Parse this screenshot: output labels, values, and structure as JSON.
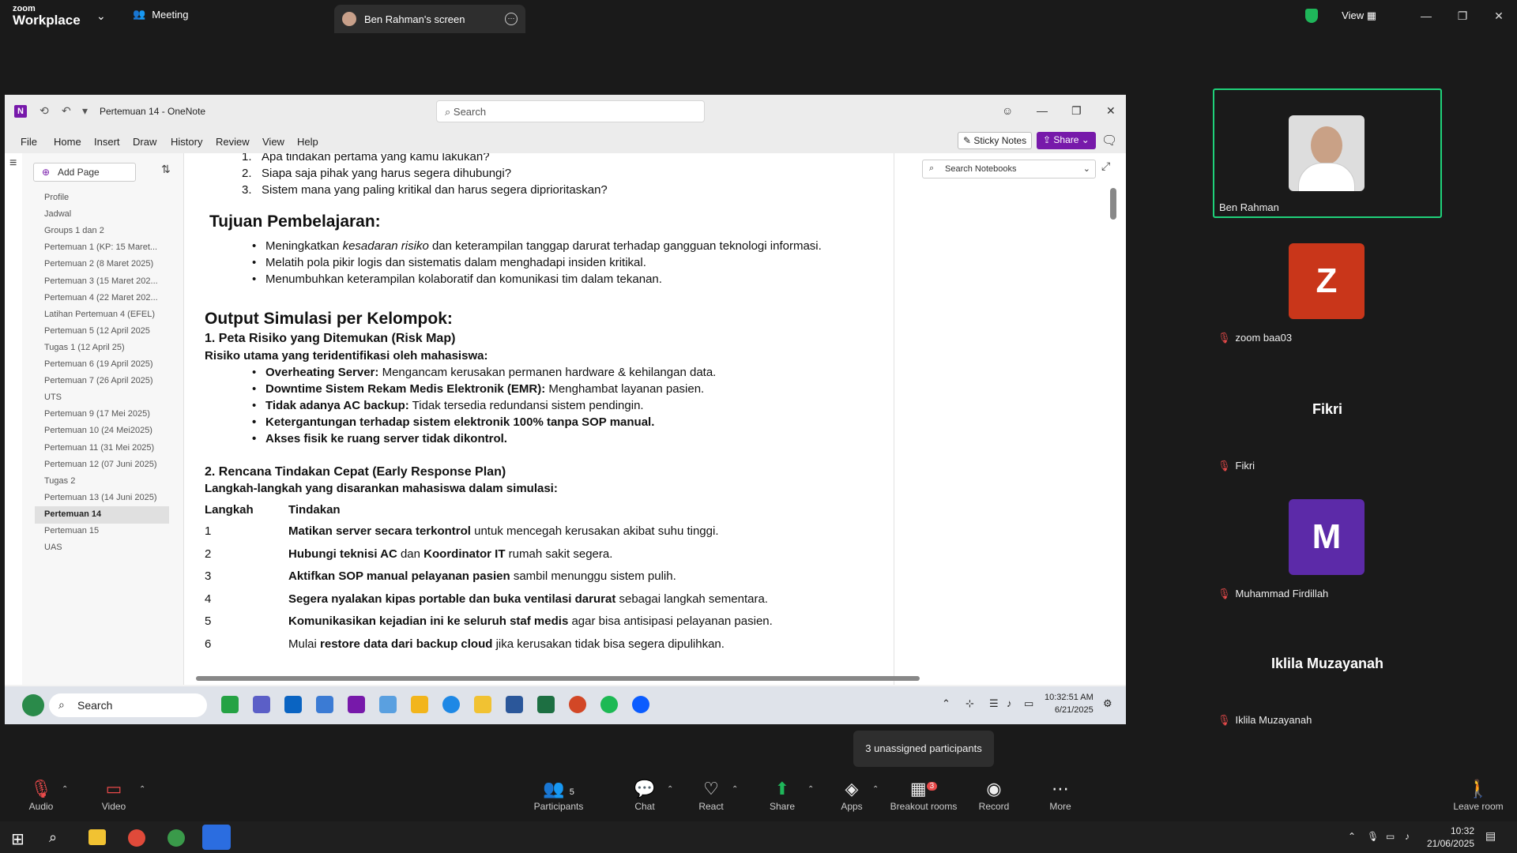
{
  "zoom_header": {
    "logo_small": "zoom",
    "logo_big": "Workplace",
    "meeting_label": "Meeting",
    "screen_tab_label": "Ben Rahman's screen",
    "view_label": "View"
  },
  "onenote": {
    "title": "Pertemuan 14 - OneNote",
    "search_placeholder": "Search",
    "menu": [
      "File",
      "Home",
      "Insert",
      "Draw",
      "History",
      "Review",
      "View",
      "Help"
    ],
    "sticky_notes": "Sticky Notes",
    "share": "Share",
    "add_page": "Add Page",
    "search_notebooks": "Search Notebooks",
    "pages": [
      "Profile",
      "Jadwal",
      "Groups 1 dan 2",
      "Pertemuan 1  (KP: 15 Maret...",
      "Pertemuan 2 (8 Maret 2025)",
      "Pertemuan 3 (15 Maret 202...",
      "Pertemuan 4 (22 Maret 202...",
      "Latihan Pertemuan 4 (EFEL)",
      "Pertemuan 5 (12 April 2025",
      "Tugas 1 (12 April 25)",
      "Pertemuan 6 (19 April 2025)",
      "Pertemuan 7 (26 April 2025)",
      "UTS",
      "Pertemuan 9 (17 Mei 2025)",
      "Pertemuan 10 (24 Mei2025)",
      "Pertemuan 11 (31 Mei 2025)",
      "Pertemuan 12 (07 Juni 2025)",
      "Tugas 2",
      "Pertemuan 13 (14 Juni 2025)",
      "Pertemuan 14",
      "Pertemuan 15",
      "UAS"
    ],
    "selected_page": "Pertemuan 14",
    "doc": {
      "q1": "Apa tindakan pertama yang kamu lakukan?",
      "q2": "Siapa saja pihak yang harus segera dihubungi?",
      "q3": "Sistem mana yang paling kritikal dan harus segera diprioritaskan?",
      "tujuan_heading": "Tujuan Pembelajaran:",
      "t1_a": "Meningkatkan ",
      "t1_em": "kesadaran risiko",
      "t1_b": " dan keterampilan tanggap darurat terhadap gangguan teknologi informasi.",
      "t2": "Melatih pola pikir logis dan sistematis dalam menghadapi insiden kritikal.",
      "t3": "Menumbuhkan keterampilan kolaboratif dan komunikasi tim dalam tekanan.",
      "output_heading": "Output Simulasi per Kelompok:",
      "peta_heading": "1. Peta Risiko yang Ditemukan (Risk Map)",
      "risiko_intro": "Risiko utama yang teridentifikasi oleh mahasiswa:",
      "r1_b": "Overheating Server:",
      "r1": " Mengancam kerusakan permanen hardware & kehilangan data.",
      "r2_b": "Downtime Sistem Rekam Medis Elektronik (EMR):",
      "r2": " Menghambat layanan pasien.",
      "r3_b": "Tidak adanya AC backup:",
      "r3": " Tidak tersedia redundansi sistem pendingin.",
      "r4_b": "Ketergantungan terhadap sistem elektronik 100% tanpa SOP manual.",
      "r5_b": "Akses fisik ke ruang server tidak dikontrol.",
      "rencana_heading": "2. Rencana Tindakan Cepat (Early Response Plan)",
      "langkah_intro": "Langkah-langkah yang disarankan mahasiswa dalam simulasi:",
      "col_langkah": "Langkah",
      "col_tindakan": "Tindakan",
      "steps": [
        {
          "n": "1",
          "b": "Matikan server secara terkontrol",
          "t": " untuk mencegah kerusakan akibat suhu tinggi."
        },
        {
          "n": "2",
          "b": "Hubungi teknisi AC",
          "t": " dan ",
          "b2": "Koordinator IT",
          "t2": " rumah sakit segera."
        },
        {
          "n": "3",
          "b": "Aktifkan SOP manual pelayanan pasien",
          "t": " sambil menunggu sistem pulih."
        },
        {
          "n": "4",
          "b": "Segera nyalakan kipas portable dan buka ventilasi darurat",
          "t": " sebagai langkah sementara."
        },
        {
          "n": "5",
          "b": "Komunikasikan kejadian ini ke seluruh staf medis",
          "t": " agar bisa antisipasi pelayanan pasien."
        },
        {
          "n": "6",
          "pre": "Mulai ",
          "b": "restore data dari backup cloud",
          "t": " jika kerusakan tidak bisa segera dipulihkan."
        }
      ]
    },
    "taskbar_search": "Search",
    "clock_time": "10:32:51 AM",
    "clock_date": "6/21/2025"
  },
  "participants": [
    {
      "name": "Ben Rahman",
      "type": "video"
    },
    {
      "name": "zoom baa03",
      "letter": "Z",
      "color": "#c9361a"
    },
    {
      "name": "Fikri",
      "big": "Fikri"
    },
    {
      "name": "Muhammad Firdillah",
      "letter": "M",
      "color": "#5c2aa8"
    },
    {
      "name": "Iklila Muzayanah",
      "big": "Iklila Muzayanah"
    }
  ],
  "tooltip": "3 unassigned participants",
  "toolbar": {
    "audio": "Audio",
    "video": "Video",
    "participants": "Participants",
    "participants_count": "5",
    "chat": "Chat",
    "react": "React",
    "share": "Share",
    "apps": "Apps",
    "breakout": "Breakout rooms",
    "breakout_badge": "3",
    "record": "Record",
    "more": "More",
    "leave": "Leave room"
  },
  "win_clock": {
    "time": "10:32",
    "date": "21/06/2025"
  },
  "colors": {
    "onenote_purple": "#7719aa",
    "zoom_share_green": "#1fb65a",
    "speaker_border": "#1fd17a"
  }
}
